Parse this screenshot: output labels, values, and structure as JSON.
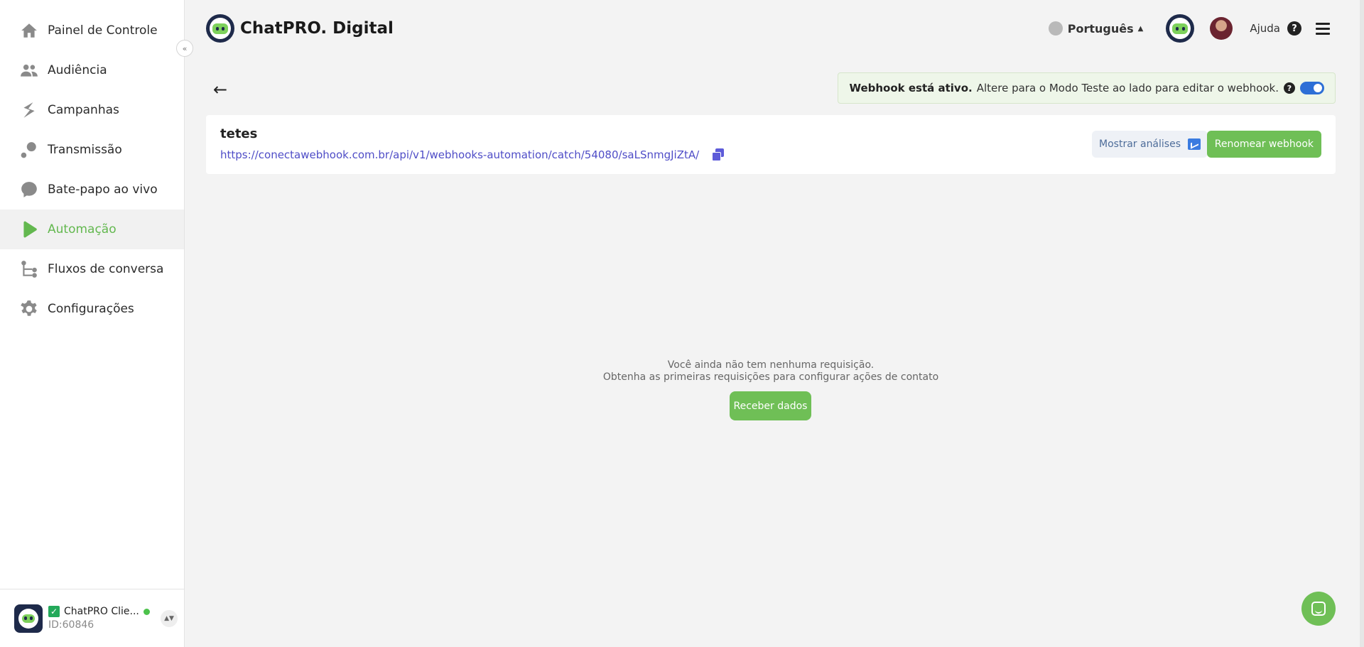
{
  "sidebar": {
    "items": [
      {
        "label": "Painel de Controle",
        "icon": "home-icon"
      },
      {
        "label": "Audiência",
        "icon": "people-icon"
      },
      {
        "label": "Campanhas",
        "icon": "campaign-icon"
      },
      {
        "label": "Transmissão",
        "icon": "broadcast-icon"
      },
      {
        "label": "Bate-papo ao vivo",
        "icon": "chat-bubble-icon"
      },
      {
        "label": "Automação",
        "icon": "play-icon",
        "active": true
      },
      {
        "label": "Fluxos de conversa",
        "icon": "flow-icon"
      },
      {
        "label": "Configurações",
        "icon": "gear-icon"
      }
    ],
    "collapse_glyph": "«",
    "account": {
      "name": "ChatPRO Clie...",
      "id": "ID:60846",
      "status_color": "#4cc24b"
    }
  },
  "header": {
    "brand": "ChatPRO. Digital",
    "language": "Português",
    "help": "Ajuda"
  },
  "notice": {
    "bold": "Webhook está ativo.",
    "text": "Altere para o Modo Teste ao lado para editar o webhook.",
    "toggle_on": true
  },
  "webhook": {
    "name": "tetes",
    "url": "https://conectawebhook.com.br/api/v1/webhooks-automation/catch/54080/saLSnmgJiZtA/",
    "analytics_label": "Mostrar análises",
    "rename_label": "Renomear webhook"
  },
  "empty_state": {
    "line1": "Você ainda não tem nenhuma requisição.",
    "line2": "Obtenha as primeiras requisições para configurar ações de contato",
    "button": "Receber dados"
  },
  "colors": {
    "accent_green": "#6fbf56",
    "link_purple": "#4f4dc7",
    "toggle_blue": "#2d6fd6"
  }
}
